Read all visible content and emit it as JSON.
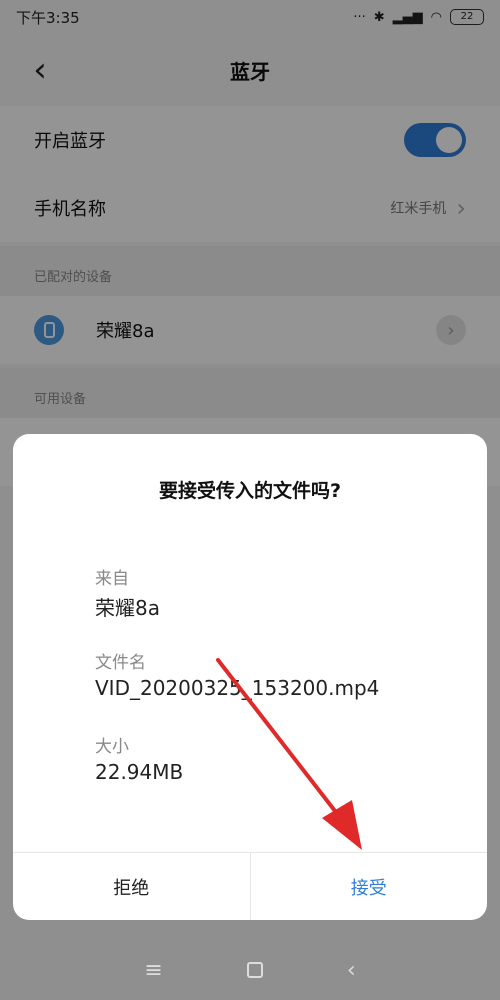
{
  "status_bar": {
    "time": "下午3:35",
    "icons": [
      "more-dots-icon",
      "bluetooth-icon",
      "signal-icon",
      "wifi-icon"
    ],
    "battery": "22"
  },
  "header": {
    "back_icon": "back-chevron-icon",
    "title": "蓝牙"
  },
  "settings": {
    "bluetooth_label": "开启蓝牙",
    "bluetooth_on": true,
    "phone_name_label": "手机名称",
    "phone_name_value": "红米手机"
  },
  "paired": {
    "header": "已配对的设备",
    "devices": [
      {
        "name": "荣耀8a"
      }
    ]
  },
  "available": {
    "header": "可用设备"
  },
  "dialog": {
    "title": "要接受传入的文件吗?",
    "from_label": "来自",
    "from_value": "荣耀8a",
    "filename_label": "文件名",
    "filename_value": "VID_20200325_153200.mp4",
    "size_label": "大小",
    "size_value": "22.94MB",
    "reject_label": "拒绝",
    "accept_label": "接受"
  },
  "nav": {
    "icons": [
      "menu-icon",
      "home-icon",
      "back-icon"
    ]
  },
  "colors": {
    "accent": "#2f7fd8",
    "annotation_arrow": "#e02a2a"
  }
}
